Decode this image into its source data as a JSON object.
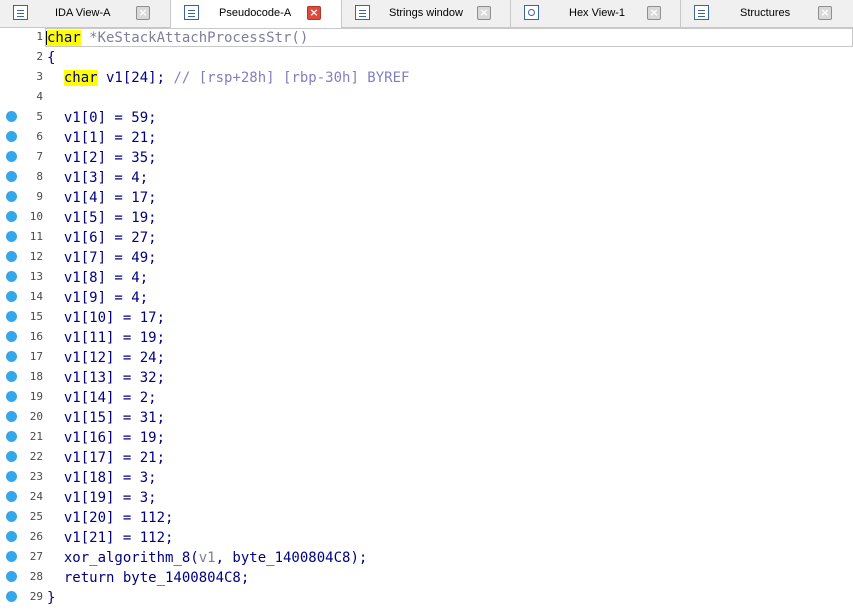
{
  "tabs": [
    {
      "label": "IDA View-A",
      "icon": "ida-view-icon",
      "active": false
    },
    {
      "label": "Pseudocode-A",
      "icon": "pseudocode-icon",
      "active": true
    },
    {
      "label": "Strings window",
      "icon": "strings-icon",
      "active": false
    },
    {
      "label": "Hex View-1",
      "icon": "hex-view-icon",
      "active": false
    },
    {
      "label": "Structures",
      "icon": "structures-icon",
      "active": false
    }
  ],
  "code": {
    "lines": [
      {
        "n": "1",
        "dot": false
      },
      {
        "n": "2",
        "dot": false
      },
      {
        "n": "3",
        "dot": false
      },
      {
        "n": "4",
        "dot": false
      },
      {
        "n": "5",
        "dot": true,
        "text": "  v1[0] = 59;"
      },
      {
        "n": "6",
        "dot": true,
        "text": "  v1[1] = 21;"
      },
      {
        "n": "7",
        "dot": true,
        "text": "  v1[2] = 35;"
      },
      {
        "n": "8",
        "dot": true,
        "text": "  v1[3] = 4;"
      },
      {
        "n": "9",
        "dot": true,
        "text": "  v1[4] = 17;"
      },
      {
        "n": "10",
        "dot": true,
        "text": "  v1[5] = 19;"
      },
      {
        "n": "11",
        "dot": true,
        "text": "  v1[6] = 27;"
      },
      {
        "n": "12",
        "dot": true,
        "text": "  v1[7] = 49;"
      },
      {
        "n": "13",
        "dot": true,
        "text": "  v1[8] = 4;"
      },
      {
        "n": "14",
        "dot": true,
        "text": "  v1[9] = 4;"
      },
      {
        "n": "15",
        "dot": true,
        "text": "  v1[10] = 17;"
      },
      {
        "n": "16",
        "dot": true,
        "text": "  v1[11] = 19;"
      },
      {
        "n": "17",
        "dot": true,
        "text": "  v1[12] = 24;"
      },
      {
        "n": "18",
        "dot": true,
        "text": "  v1[13] = 32;"
      },
      {
        "n": "19",
        "dot": true,
        "text": "  v1[14] = 2;"
      },
      {
        "n": "20",
        "dot": true,
        "text": "  v1[15] = 31;"
      },
      {
        "n": "21",
        "dot": true,
        "text": "  v1[16] = 19;"
      },
      {
        "n": "22",
        "dot": true,
        "text": "  v1[17] = 21;"
      },
      {
        "n": "23",
        "dot": true,
        "text": "  v1[18] = 3;"
      },
      {
        "n": "24",
        "dot": true,
        "text": "  v1[19] = 3;"
      },
      {
        "n": "25",
        "dot": true,
        "text": "  v1[20] = 112;"
      },
      {
        "n": "26",
        "dot": true,
        "text": "  v1[21] = 112;"
      },
      {
        "n": "27",
        "dot": true
      },
      {
        "n": "28",
        "dot": true,
        "text": "  return byte_1400804C8;"
      },
      {
        "n": "29",
        "dot": true,
        "text": "}"
      }
    ],
    "line1": {
      "kw": "char",
      "rest": " *KeStackAttachProcessStr()"
    },
    "line2": "{",
    "line3": {
      "indent": "  ",
      "kw": "char",
      "decl": " v1[24]; ",
      "comment": "// [rsp+28h] [rbp-30h] BYREF"
    },
    "line27": {
      "pre": "  xor_algorithm_8(",
      "arg": "v1",
      "post": ", byte_1400804C8);"
    }
  },
  "colors": {
    "highlight": "#ffff00",
    "code": "#000080",
    "breakpoint_dot": "#35a6ea"
  }
}
